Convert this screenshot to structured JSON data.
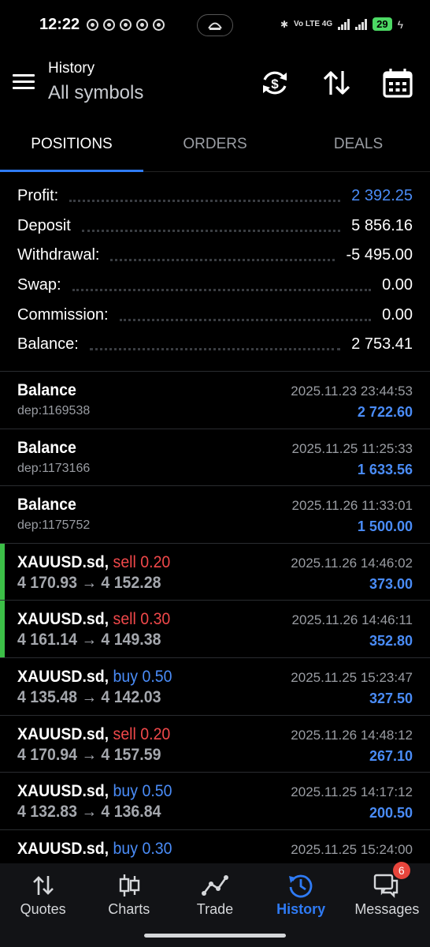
{
  "status_bar": {
    "time": "12:22",
    "network": "Vo LTE 4G",
    "battery": "29"
  },
  "header": {
    "title": "History",
    "subtitle": "All symbols"
  },
  "tabs": [
    {
      "label": "POSITIONS",
      "active": true
    },
    {
      "label": "ORDERS",
      "active": false
    },
    {
      "label": "DEALS",
      "active": false
    }
  ],
  "summary": [
    {
      "label": "Profit:",
      "value": "2 392.25",
      "highlight": true
    },
    {
      "label": "Deposit",
      "value": "5 856.16",
      "highlight": false
    },
    {
      "label": "Withdrawal:",
      "value": "-5 495.00",
      "highlight": false
    },
    {
      "label": "Swap:",
      "value": "0.00",
      "highlight": false
    },
    {
      "label": "Commission:",
      "value": "0.00",
      "highlight": false
    },
    {
      "label": "Balance:",
      "value": "2 753.41",
      "highlight": false
    }
  ],
  "deals": [
    {
      "title": "Balance",
      "sub": "dep:1169538",
      "time": "2025.11.23 23:44:53",
      "amount": "2 722.60"
    },
    {
      "title": "Balance",
      "sub": "dep:1173166",
      "time": "2025.11.25 11:25:33",
      "amount": "1 633.56"
    },
    {
      "title": "Balance",
      "sub": "dep:1175752",
      "time": "2025.11.26 11:33:01",
      "amount": "1 500.00"
    }
  ],
  "positions": [
    {
      "symbol": "XAUUSD.sd,",
      "side": "sell 0.20",
      "side_type": "sell",
      "prices": "4 170.93 → 4 152.28",
      "time": "2025.11.26 14:46:02",
      "profit": "373.00",
      "marker": true
    },
    {
      "symbol": "XAUUSD.sd,",
      "side": "sell 0.30",
      "side_type": "sell",
      "prices": "4 161.14 → 4 149.38",
      "time": "2025.11.26 14:46:11",
      "profit": "352.80",
      "marker": true
    },
    {
      "symbol": "XAUUSD.sd,",
      "side": "buy 0.50",
      "side_type": "buy",
      "prices": "4 135.48 → 4 142.03",
      "time": "2025.11.25 15:23:47",
      "profit": "327.50",
      "marker": false
    },
    {
      "symbol": "XAUUSD.sd,",
      "side": "sell 0.20",
      "side_type": "sell",
      "prices": "4 170.94 → 4 157.59",
      "time": "2025.11.26 14:48:12",
      "profit": "267.10",
      "marker": false
    },
    {
      "symbol": "XAUUSD.sd,",
      "side": "buy 0.50",
      "side_type": "buy",
      "prices": "4 132.83 → 4 136.84",
      "time": "2025.11.25 14:17:12",
      "profit": "200.50",
      "marker": false
    },
    {
      "symbol": "XAUUSD.sd,",
      "side": "buy 0.30",
      "side_type": "buy",
      "prices": "",
      "time": "2025.11.25 15:24:00",
      "profit": "",
      "marker": false
    }
  ],
  "bottom_nav": [
    {
      "label": "Quotes",
      "icon": "quotes-arrows-icon",
      "active": false
    },
    {
      "label": "Charts",
      "icon": "candlestick-icon",
      "active": false
    },
    {
      "label": "Trade",
      "icon": "trade-line-icon",
      "active": false
    },
    {
      "label": "History",
      "icon": "history-clock-icon",
      "active": true
    },
    {
      "label": "Messages",
      "icon": "messages-icon",
      "active": false,
      "badge": "6"
    }
  ],
  "colors": {
    "accent": "#2f7bf5",
    "profit_blue": "#4a8cf7",
    "sell_red": "#f0484a",
    "marker_green": "#3cbf47"
  }
}
